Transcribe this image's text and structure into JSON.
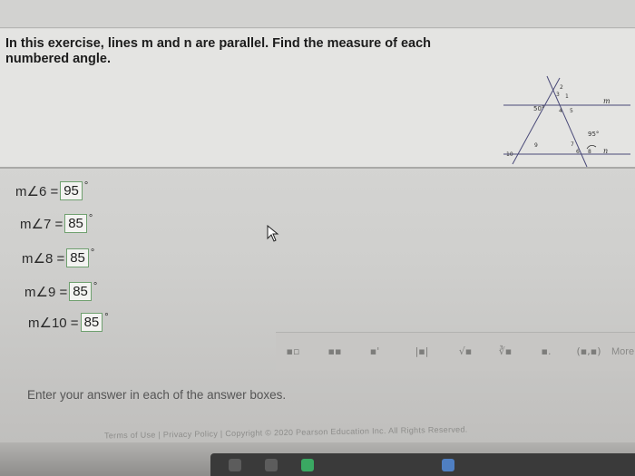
{
  "question": {
    "prompt": "In this exercise, lines m and n are parallel.  Find the measure of each numbered angle."
  },
  "figure": {
    "angle_labels": {
      "a1": "1",
      "a2": "2",
      "a3": "3",
      "a4": "4",
      "a5": "5",
      "a6": "6",
      "a7": "7",
      "a8": "8",
      "a9": "9",
      "a10": "10"
    },
    "given_angle_top": "50°",
    "given_angle_bottom": "95°",
    "line_m": "m",
    "line_n": "n"
  },
  "answers": [
    {
      "label": "m∠6 =",
      "value": "95",
      "unit": "°"
    },
    {
      "label": "m∠7 =",
      "value": "85",
      "unit": "°"
    },
    {
      "label": "m∠8 =",
      "value": "85",
      "unit": "°"
    },
    {
      "label": "m∠9 =",
      "value": "85",
      "unit": "°"
    },
    {
      "label": "m∠10 =",
      "value": "85",
      "unit": "°"
    }
  ],
  "toolbar": {
    "tools": [
      "▪▫",
      "▪▪",
      "▪'",
      "|▪|",
      "√▪",
      "∛▪",
      "▪.",
      "(▪,▪)"
    ],
    "more_label": "More"
  },
  "hint": "Enter your answer in each of the answer boxes.",
  "footer": "Terms of Use | Privacy Policy | Copyright © 2020 Pearson Education Inc. All Rights Reserved."
}
